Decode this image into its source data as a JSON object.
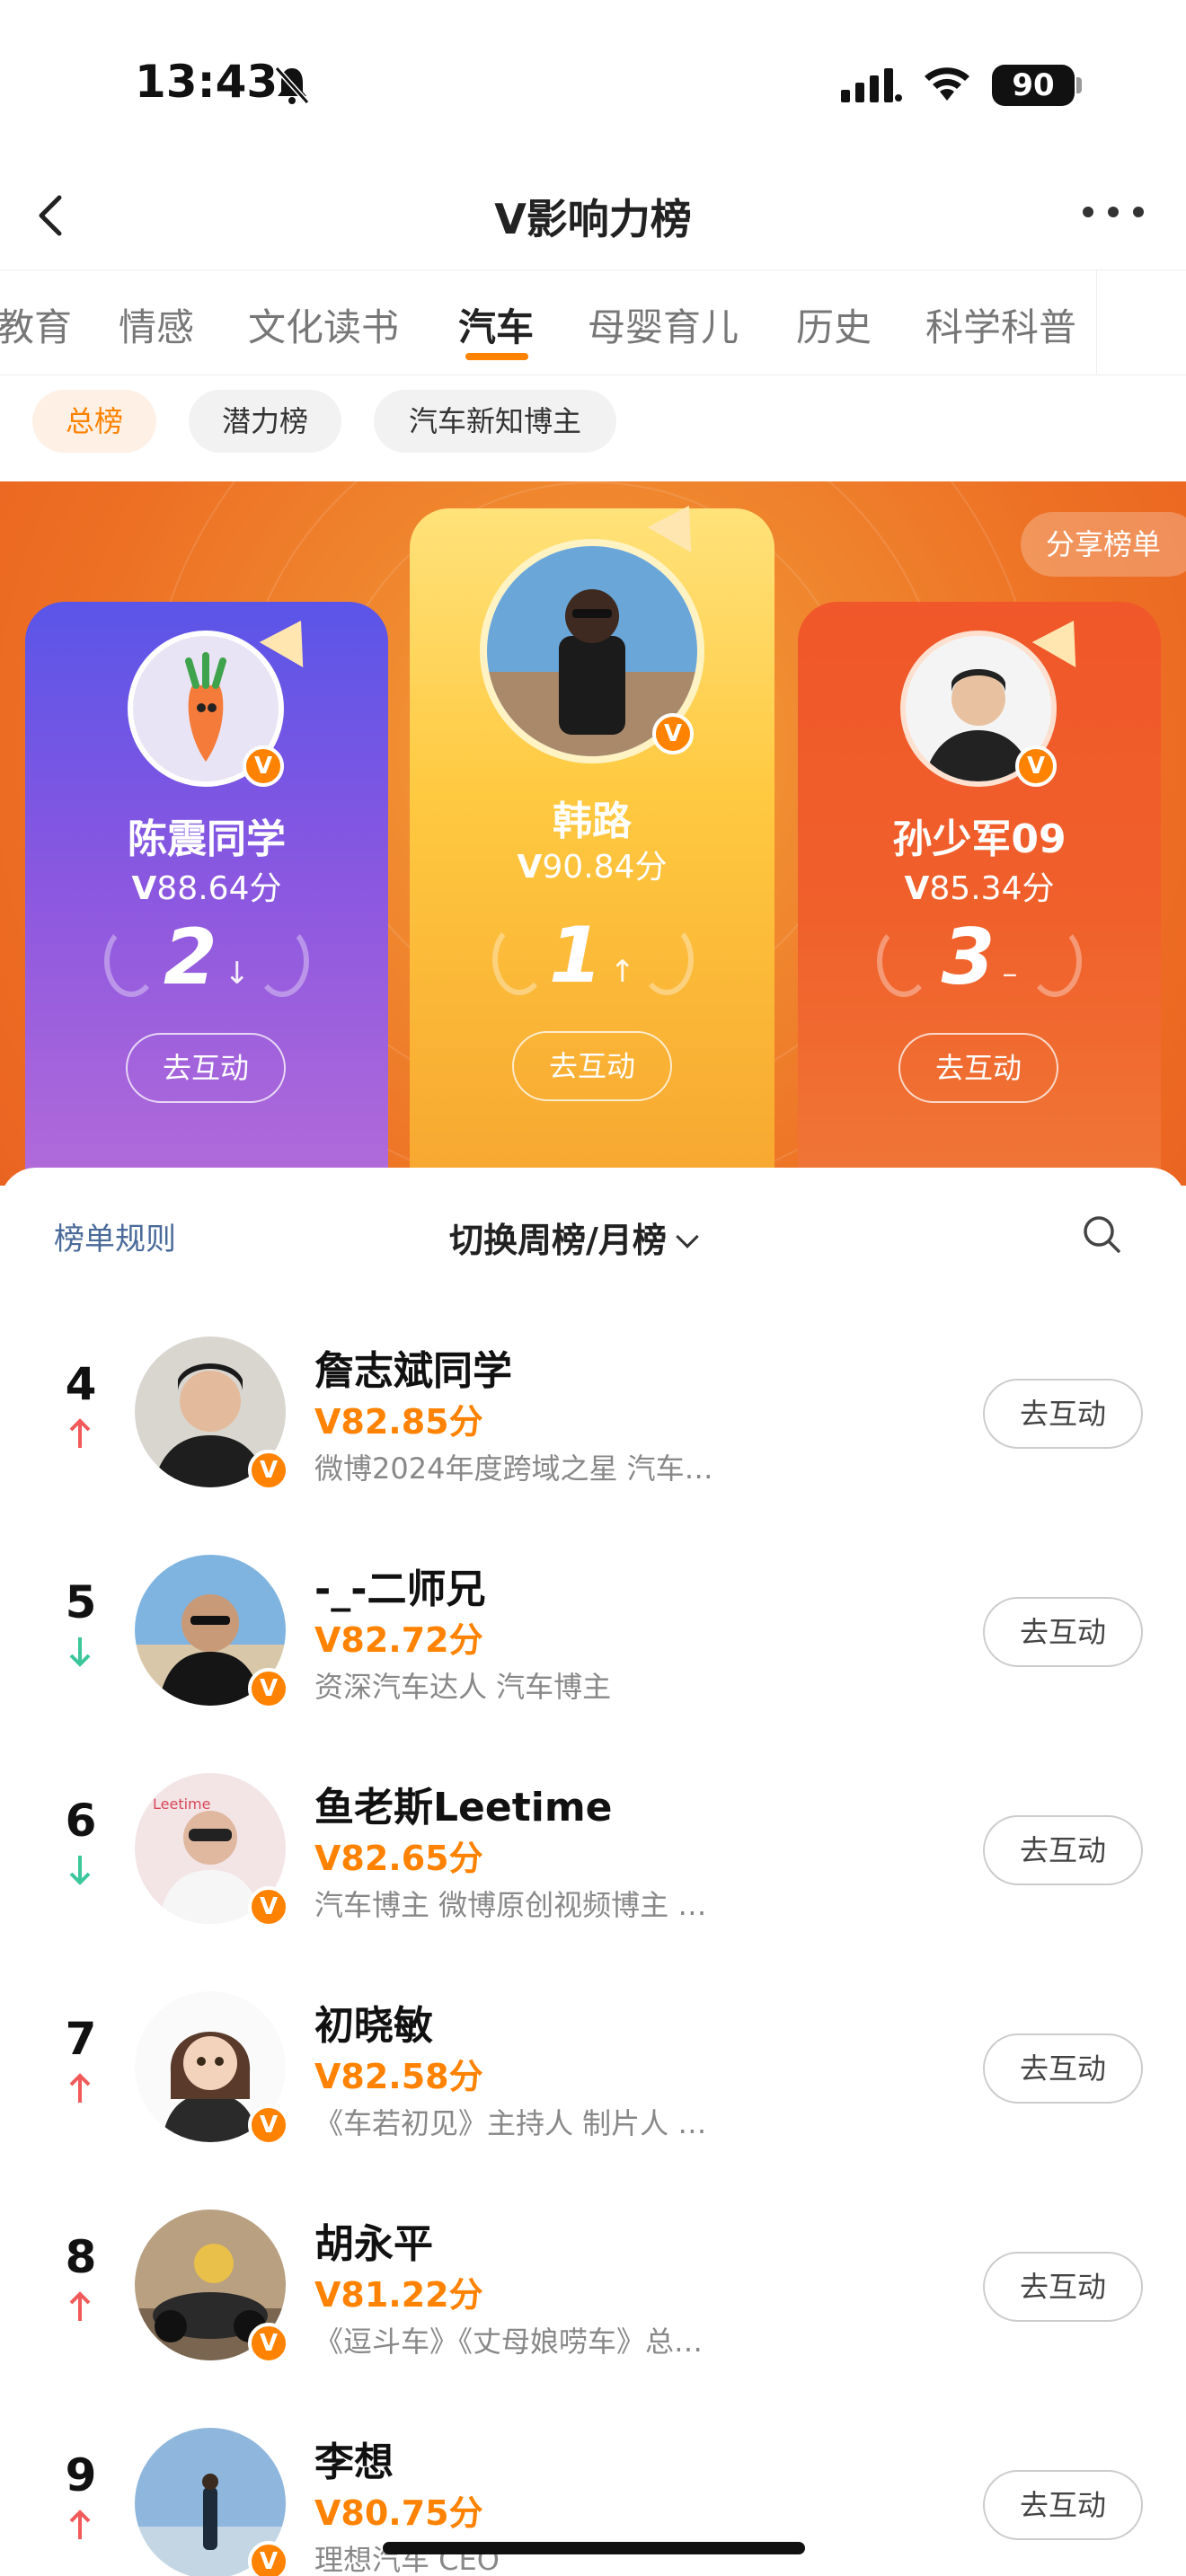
{
  "status_bar": {
    "time": "13:43",
    "battery": "90"
  },
  "nav": {
    "title": "V影响力榜"
  },
  "categories": [
    {
      "label": "教育",
      "active": false
    },
    {
      "label": "情感",
      "active": false
    },
    {
      "label": "文化读书",
      "active": false
    },
    {
      "label": "汽车",
      "active": true
    },
    {
      "label": "母婴育儿",
      "active": false
    },
    {
      "label": "历史",
      "active": false
    },
    {
      "label": "科学科普",
      "active": false
    }
  ],
  "subtabs": [
    {
      "label": "总榜",
      "active": true
    },
    {
      "label": "潜力榜",
      "active": false
    },
    {
      "label": "汽车新知博主",
      "active": false
    }
  ],
  "hero": {
    "share_label": "分享榜单",
    "podium": [
      {
        "name": "陈震同学",
        "score": "88.64分",
        "rank": "2",
        "trend": "down",
        "button": "去互动"
      },
      {
        "name": "韩路",
        "score": "90.84分",
        "rank": "1",
        "trend": "up",
        "button": "去互动"
      },
      {
        "name": "孙少军09",
        "score": "85.34分",
        "rank": "3",
        "trend": "same",
        "button": "去互动"
      }
    ]
  },
  "panel": {
    "rules_label": "榜单规则",
    "switch_label": "切换周榜/月榜",
    "rows": [
      {
        "rank": "4",
        "trend": "up",
        "name": "詹志斌同学",
        "score": "82.85分",
        "desc": "微博2024年度跨域之星 汽车…",
        "button": "去互动"
      },
      {
        "rank": "5",
        "trend": "down",
        "name": "-_-二师兄",
        "score": "82.72分",
        "desc": "资深汽车达人 汽车博主",
        "button": "去互动"
      },
      {
        "rank": "6",
        "trend": "down",
        "name": "鱼老斯Leetime",
        "score": "82.65分",
        "desc": "汽车博主 微博原创视频博主 …",
        "button": "去互动"
      },
      {
        "rank": "7",
        "trend": "up",
        "name": "初晓敏",
        "score": "82.58分",
        "desc": "《车若初见》主持人 制片人 …",
        "button": "去互动"
      },
      {
        "rank": "8",
        "trend": "up",
        "name": "胡永平",
        "score": "81.22分",
        "desc": "《逗斗车》《丈母娘唠车》总…",
        "button": "去互动"
      },
      {
        "rank": "9",
        "trend": "up",
        "name": "李想",
        "score": "80.75分",
        "desc": "理想汽车 CEO",
        "button": "去互动"
      }
    ]
  },
  "colors": {
    "accent": "#ff8200",
    "up": "#f25a5a",
    "down": "#3cc79a"
  }
}
